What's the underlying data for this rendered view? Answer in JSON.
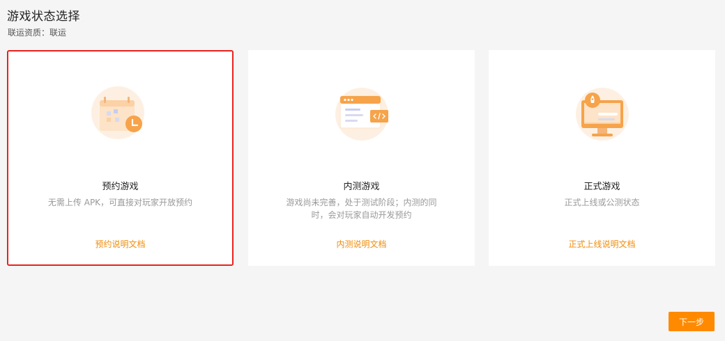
{
  "header": {
    "title": "游戏状态选择",
    "qualification": "联运资质：联运"
  },
  "cards": [
    {
      "title": "预约游戏",
      "description": "无需上传 APK，可直接对玩家开放预约",
      "link": "预约说明文档",
      "selected": true,
      "icon": "calendar-clock-icon"
    },
    {
      "title": "内测游戏",
      "description": "游戏尚未完善，处于测试阶段；内测的同时，会对玩家自动开发预约",
      "link": "内测说明文档",
      "selected": false,
      "icon": "browser-code-icon"
    },
    {
      "title": "正式游戏",
      "description": "正式上线或公测状态",
      "link": "正式上线说明文档",
      "selected": false,
      "icon": "monitor-rocket-icon"
    }
  ],
  "footer": {
    "next_label": "下一步"
  },
  "colors": {
    "accent": "#ff8a00",
    "link": "#f08c0a",
    "selected_border": "#e8211c"
  }
}
